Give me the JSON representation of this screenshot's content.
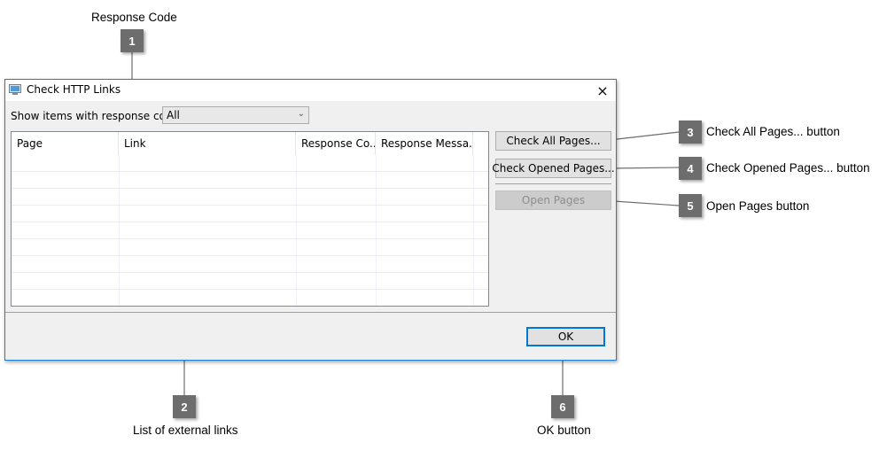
{
  "annotations": [
    {
      "number": "1",
      "label": "Response Code"
    },
    {
      "number": "2",
      "label": "List of external links"
    },
    {
      "number": "3",
      "label": "Check All Pages... button"
    },
    {
      "number": "4",
      "label": "Check Opened Pages... button"
    },
    {
      "number": "5",
      "label": "Open Pages button"
    },
    {
      "number": "6",
      "label": "OK button"
    }
  ],
  "dialog": {
    "title": "Check HTTP Links",
    "close_icon": "×",
    "filter": {
      "label": "Show items with response code",
      "selected": "All",
      "arrow_icon": "⌄"
    },
    "list": {
      "columns": [
        "Page",
        "Link",
        "Response Co...",
        "Response Messa..."
      ],
      "rows": []
    },
    "buttons": {
      "check_all": "Check All Pages...",
      "check_opened": "Check Opened Pages...",
      "open_pages": "Open Pages",
      "ok": "OK"
    },
    "colors": {
      "accent": "#0078d7",
      "badge": "#6d6d6d"
    }
  }
}
